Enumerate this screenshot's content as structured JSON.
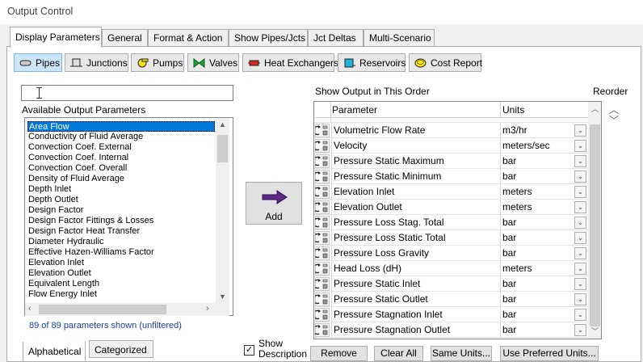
{
  "window": {
    "title": "Output Control"
  },
  "tabs": [
    {
      "label": "Display Parameters",
      "active": true
    },
    {
      "label": "General"
    },
    {
      "label": "Format & Action"
    },
    {
      "label": "Show Pipes/Jcts"
    },
    {
      "label": "Jct Deltas"
    },
    {
      "label": "Multi-Scenario"
    }
  ],
  "toolbar": [
    {
      "label": "Pipes",
      "icon": "pipe-icon",
      "active": true
    },
    {
      "label": "Junctions",
      "icon": "junction-icon"
    },
    {
      "label": "Pumps",
      "icon": "pump-icon"
    },
    {
      "label": "Valves",
      "icon": "valve-icon"
    },
    {
      "label": "Heat Exchangers",
      "icon": "heat-exchanger-icon"
    },
    {
      "label": "Reservoirs",
      "icon": "reservoir-icon"
    },
    {
      "label": "Cost Report",
      "icon": "cost-report-icon"
    }
  ],
  "search": {
    "value": ""
  },
  "available": {
    "title": "Available Output Parameters",
    "items": [
      "Area Flow",
      "Conductivity of Fluid Average",
      "Convection Coef. External",
      "Convection Coef. Internal",
      "Convection Coef. Overall",
      "Density of Fluid Average",
      "Depth Inlet",
      "Depth Outlet",
      "Design Factor",
      "Design Factor Fittings & Losses",
      "Design Factor Heat Transfer",
      "Diameter Hydraulic",
      "Effective Hazen-Williams Factor",
      "Elevation Inlet",
      "Elevation Outlet",
      "Equivalent Length",
      "Flow Energy Inlet"
    ],
    "selected_index": 0,
    "count_text": "89 of 89 parameters shown (unfiltered)"
  },
  "add_button": {
    "label": "Add"
  },
  "order": {
    "title": "Show Output in This Order",
    "reorder_label": "Reorder",
    "col_parameter": "Parameter",
    "col_units": "Units",
    "rows": [
      {
        "parameter": "Volumetric Flow Rate",
        "units": "m3/hr"
      },
      {
        "parameter": "Velocity",
        "units": "meters/sec"
      },
      {
        "parameter": "Pressure Static Maximum",
        "units": "bar"
      },
      {
        "parameter": "Pressure Static Minimum",
        "units": "bar"
      },
      {
        "parameter": "Elevation Inlet",
        "units": "meters"
      },
      {
        "parameter": "Elevation Outlet",
        "units": "meters"
      },
      {
        "parameter": "Pressure Loss Stag. Total",
        "units": "bar"
      },
      {
        "parameter": "Pressure Loss Static Total",
        "units": "bar"
      },
      {
        "parameter": "Pressure Loss Gravity",
        "units": "bar"
      },
      {
        "parameter": "Head Loss (dH)",
        "units": "meters"
      },
      {
        "parameter": "Pressure Static Inlet",
        "units": "bar"
      },
      {
        "parameter": "Pressure Static Outlet",
        "units": "bar"
      },
      {
        "parameter": "Pressure Stagnation Inlet",
        "units": "bar"
      },
      {
        "parameter": "Pressure Stagnation Outlet",
        "units": "bar"
      }
    ]
  },
  "bottom_tabs": [
    {
      "label": "Alphabetical",
      "active": true
    },
    {
      "label": "Categorized"
    }
  ],
  "show_description": {
    "label_line1": "Show",
    "label_line2": "Description",
    "checked": true
  },
  "buttons": {
    "remove": "Remove",
    "clear_all": "Clear All",
    "same_units": "Same Units...",
    "use_preferred": "Use Preferred Units..."
  },
  "colors": {
    "selection": "#0078d7",
    "active_toolbar": "#cde6f7",
    "pump_yellow": "#f5e51b",
    "valve_green": "#1ea33a",
    "hx_red": "#d9261c",
    "reservoir_cyan": "#1fb3d6",
    "arrow_purple": "#5b2a86"
  }
}
